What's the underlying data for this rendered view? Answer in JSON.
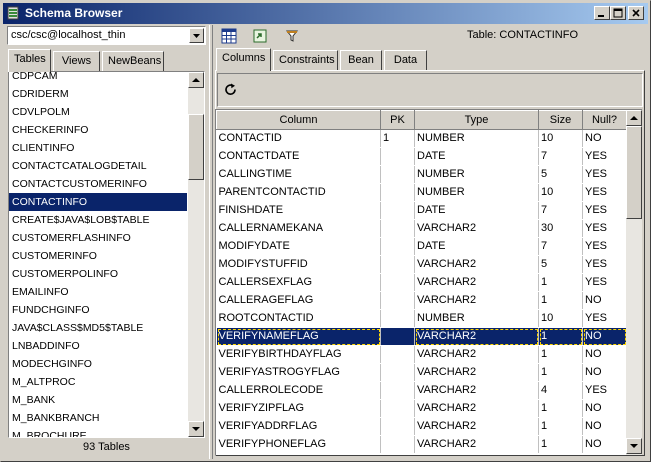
{
  "window": {
    "title": "Schema Browser"
  },
  "connection": {
    "selected": "csc/csc@localhost_thin"
  },
  "left_tabs": [
    {
      "label": "Tables"
    },
    {
      "label": "Views"
    },
    {
      "label": "NewBeans"
    }
  ],
  "tables_list": {
    "items": [
      "CDPCAM",
      "CDRIDERM",
      "CDVLPOLM",
      "CHECKERINFO",
      "CLIENTINFO",
      "CONTACTCATALOGDETAIL",
      "CONTACTCUSTOMERINFO",
      "CONTACTINFO",
      "CREATE$JAVA$LOB$TABLE",
      "CUSTOMERFLASHINFO",
      "CUSTOMERINFO",
      "CUSTOMERPOLINFO",
      "EMAILINFO",
      "FUNDCHGINFO",
      "JAVA$CLASS$MD5$TABLE",
      "LNBADDINFO",
      "MODECHGINFO",
      "M_ALTPROC",
      "M_BANK",
      "M_BANKBRANCH",
      "M_BROCHURE"
    ],
    "selected_index": 7,
    "count_label": "93 Tables"
  },
  "toolbar": {
    "icons": [
      "grid-icon",
      "export-icon",
      "filter-icon"
    ]
  },
  "table_label": "Table: CONTACTINFO",
  "right_tabs": [
    {
      "label": "Columns"
    },
    {
      "label": "Constraints"
    },
    {
      "label": "Bean"
    },
    {
      "label": "Data"
    }
  ],
  "columns_grid": {
    "headers": [
      "Column",
      "PK",
      "Type",
      "Size",
      "Null?"
    ],
    "selected_index": 11,
    "rows": [
      [
        "CONTACTID",
        "1",
        "NUMBER",
        "10",
        "NO"
      ],
      [
        "CONTACTDATE",
        "",
        "DATE",
        "7",
        "YES"
      ],
      [
        "CALLINGTIME",
        "",
        "NUMBER",
        "5",
        "YES"
      ],
      [
        "PARENTCONTACTID",
        "",
        "NUMBER",
        "10",
        "YES"
      ],
      [
        "FINISHDATE",
        "",
        "DATE",
        "7",
        "YES"
      ],
      [
        "CALLERNAMEKANA",
        "",
        "VARCHAR2",
        "30",
        "YES"
      ],
      [
        "MODIFYDATE",
        "",
        "DATE",
        "7",
        "YES"
      ],
      [
        "MODIFYSTUFFID",
        "",
        "VARCHAR2",
        "5",
        "YES"
      ],
      [
        "CALLERSEXFLAG",
        "",
        "VARCHAR2",
        "1",
        "YES"
      ],
      [
        "CALLERAGEFLAG",
        "",
        "VARCHAR2",
        "1",
        "NO"
      ],
      [
        "ROOTCONTACTID",
        "",
        "NUMBER",
        "10",
        "YES"
      ],
      [
        "VERIFYNAMEFLAG",
        "",
        "VARCHAR2",
        "1",
        "NO"
      ],
      [
        "VERIFYBIRTHDAYFLAG",
        "",
        "VARCHAR2",
        "1",
        "NO"
      ],
      [
        "VERIFYASTROGYFLAG",
        "",
        "VARCHAR2",
        "1",
        "NO"
      ],
      [
        "CALLERROLECODE",
        "",
        "VARCHAR2",
        "4",
        "YES"
      ],
      [
        "VERIFYZIPFLAG",
        "",
        "VARCHAR2",
        "1",
        "NO"
      ],
      [
        "VERIFYADDRFLAG",
        "",
        "VARCHAR2",
        "1",
        "NO"
      ],
      [
        "VERIFYPHONEFLAG",
        "",
        "VARCHAR2",
        "1",
        "NO"
      ]
    ]
  },
  "colors": {
    "titlebar_start": "#0a246a",
    "titlebar_end": "#a6caf0",
    "selection": "#0a246a",
    "face": "#d4d0c8"
  }
}
